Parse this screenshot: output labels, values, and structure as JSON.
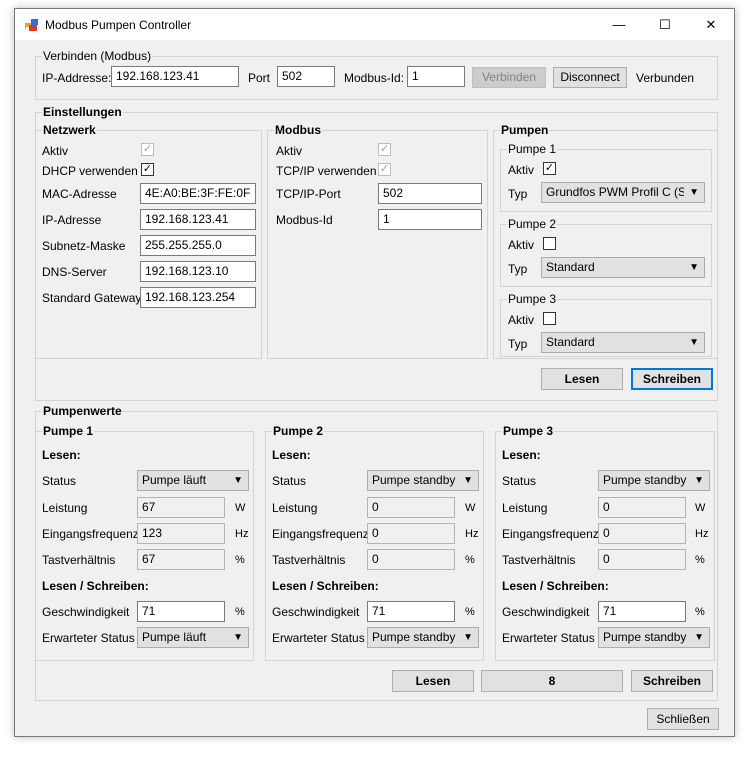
{
  "window": {
    "title": "Modbus Pumpen Controller",
    "minimize": "—",
    "maximize": "☐",
    "close": "✕"
  },
  "connect": {
    "legend": "Verbinden (Modbus)",
    "ip_label": "IP-Addresse:",
    "ip_value": "192.168.123.41",
    "port_label": "Port",
    "port_value": "502",
    "id_label": "Modbus-Id:",
    "id_value": "1",
    "connect_button": "Verbinden",
    "disconnect_button": "Disconnect",
    "status": "Verbunden"
  },
  "settings": {
    "legend": "Einstellungen",
    "network": {
      "legend": "Netzwerk",
      "active_label": "Aktiv",
      "active_checked": "✓",
      "dhcp_label": "DHCP verwenden",
      "dhcp_checked": "✓",
      "mac_label": "MAC-Adresse",
      "mac_value": "4E:A0:BE:3F:FE:0F",
      "ip_label": "IP-Adresse",
      "ip_value": "192.168.123.41",
      "subnet_label": "Subnetz-Maske",
      "subnet_value": "255.255.255.0",
      "dns_label": "DNS-Server",
      "dns_value": "192.168.123.10",
      "gateway_label": "Standard Gateway",
      "gateway_value": "192.168.123.254"
    },
    "modbus": {
      "legend": "Modbus",
      "active_label": "Aktiv",
      "active_checked": "✓",
      "tcp_label": "TCP/IP verwenden",
      "tcp_checked": "✓",
      "port_label": "TCP/IP-Port",
      "port_value": "502",
      "id_label": "Modbus-Id",
      "id_value": "1"
    },
    "pumps": {
      "legend": "Pumpen",
      "items": [
        {
          "legend": "Pumpe 1",
          "active_label": "Aktiv",
          "active_checked": "✓",
          "type_label": "Typ",
          "type_value": "Grundfos PWM Profil C (Solar)"
        },
        {
          "legend": "Pumpe 2",
          "active_label": "Aktiv",
          "active_checked": "",
          "type_label": "Typ",
          "type_value": "Standard"
        },
        {
          "legend": "Pumpe 3",
          "active_label": "Aktiv",
          "active_checked": "",
          "type_label": "Typ",
          "type_value": "Standard"
        }
      ]
    },
    "read_button": "Lesen",
    "write_button": "Schreiben"
  },
  "values": {
    "legend": "Pumpenwerte",
    "pumps": [
      {
        "legend": "Pumpe 1",
        "read_heading": "Lesen:",
        "status_label": "Status",
        "status_value": "Pumpe läuft",
        "power_label": "Leistung",
        "power_value": "67",
        "power_unit": "W",
        "freq_label": "Eingangsfrequenz",
        "freq_value": "123",
        "freq_unit": "Hz",
        "duty_label": "Tastverhältnis",
        "duty_value": "67",
        "duty_unit": "%",
        "rw_heading": "Lesen / Schreiben:",
        "speed_label": "Geschwindigkeit",
        "speed_value": "71",
        "speed_unit": "%",
        "expected_label": "Erwarteter Status",
        "expected_value": "Pumpe läuft"
      },
      {
        "legend": "Pumpe 2",
        "read_heading": "Lesen:",
        "status_label": "Status",
        "status_value": "Pumpe standby",
        "power_label": "Leistung",
        "power_value": "0",
        "power_unit": "W",
        "freq_label": "Eingangsfrequenz",
        "freq_value": "0",
        "freq_unit": "Hz",
        "duty_label": "Tastverhältnis",
        "duty_value": "0",
        "duty_unit": "%",
        "rw_heading": "Lesen / Schreiben:",
        "speed_label": "Geschwindigkeit",
        "speed_value": "71",
        "speed_unit": "%",
        "expected_label": "Erwarteter Status",
        "expected_value": "Pumpe standby"
      },
      {
        "legend": "Pumpe 3",
        "read_heading": "Lesen:",
        "status_label": "Status",
        "status_value": "Pumpe standby",
        "power_label": "Leistung",
        "power_value": "0",
        "power_unit": "W",
        "freq_label": "Eingangsfrequenz",
        "freq_value": "0",
        "freq_unit": "Hz",
        "duty_label": "Tastverhältnis",
        "duty_value": "0",
        "duty_unit": "%",
        "rw_heading": "Lesen / Schreiben:",
        "speed_label": "Geschwindigkeit",
        "speed_value": "71",
        "speed_unit": "%",
        "expected_label": "Erwarteter Status",
        "expected_value": "Pumpe standby"
      }
    ],
    "read_button": "Lesen",
    "counter": "8",
    "write_button": "Schreiben"
  },
  "close_button": "Schließen",
  "icons": {
    "app": "app-icon",
    "combo_arrow": "chevron-down-icon",
    "check": "checkmark-icon"
  },
  "colors": {
    "window_bg": "#f0f0f0",
    "titlebar_bg": "#ffffff",
    "button_bg": "#e1e1e1",
    "focus_border": "#0078d7"
  }
}
